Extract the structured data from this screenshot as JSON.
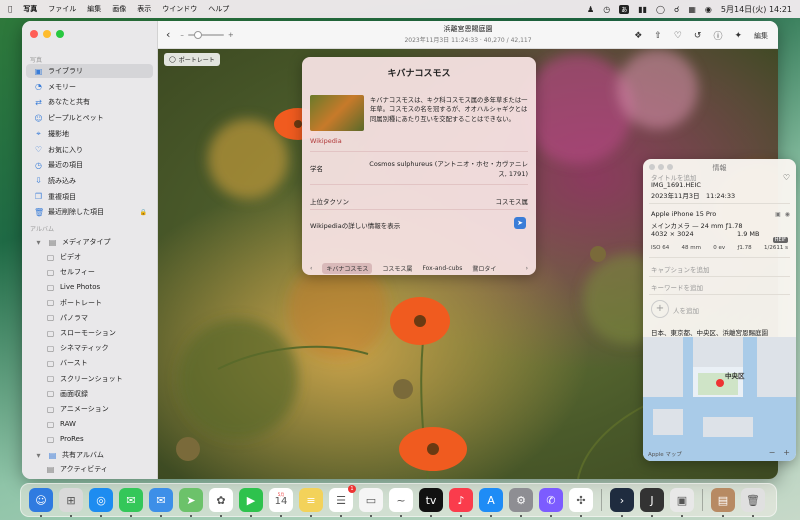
{
  "menubar": {
    "apple_icon": "apple-logo",
    "items": [
      "写真",
      "ファイル",
      "編集",
      "画像",
      "表示",
      "ウインドウ",
      "ヘルプ"
    ],
    "keyboard_badge": "あ",
    "datetime": "5月14日(火) 14:21"
  },
  "sidebar": {
    "section_photos": "写真",
    "items": [
      {
        "label": "ライブラリ",
        "icon": "photo-library-icon",
        "selected": true
      },
      {
        "label": "メモリー",
        "icon": "memories-icon"
      },
      {
        "label": "あなたと共有",
        "icon": "shared-with-you-icon"
      },
      {
        "label": "ピープルとペット",
        "icon": "people-icon"
      },
      {
        "label": "撮影地",
        "icon": "places-icon"
      },
      {
        "label": "お気に入り",
        "icon": "heart-icon"
      },
      {
        "label": "最近の項目",
        "icon": "clock-icon"
      },
      {
        "label": "読み込み",
        "icon": "import-icon"
      },
      {
        "label": "重複項目",
        "icon": "duplicates-icon"
      },
      {
        "label": "最近削除した項目",
        "icon": "trash-icon",
        "locked": true
      }
    ],
    "section_albums": "アルバム",
    "media_types": {
      "label": "メディアタイプ",
      "items": [
        {
          "label": "ビデオ",
          "icon": "video-icon"
        },
        {
          "label": "セルフィー",
          "icon": "selfie-icon"
        },
        {
          "label": "Live Photos",
          "icon": "live-photo-icon"
        },
        {
          "label": "ポートレート",
          "icon": "portrait-icon"
        },
        {
          "label": "パノラマ",
          "icon": "panorama-icon"
        },
        {
          "label": "スローモーション",
          "icon": "slomo-icon"
        },
        {
          "label": "シネマティック",
          "icon": "cinematic-icon"
        },
        {
          "label": "バースト",
          "icon": "burst-icon"
        },
        {
          "label": "スクリーンショット",
          "icon": "screenshot-icon"
        },
        {
          "label": "画面収録",
          "icon": "screen-recording-icon"
        },
        {
          "label": "アニメーション",
          "icon": "animation-icon"
        },
        {
          "label": "RAW",
          "icon": "raw-icon"
        },
        {
          "label": "ProRes",
          "icon": "prores-icon"
        }
      ]
    },
    "shared_albums": {
      "label": "共有アルバム",
      "child": "アクティビティ"
    }
  },
  "toolbar": {
    "title": "浜離宮恩賜庭園",
    "subtitle": "2023年11月3日 11:24:33  ·  40,270 / 42,117",
    "edit_label": "編集",
    "zoom_minus": "–",
    "zoom_plus": "+"
  },
  "photo": {
    "portrait_badge": "ポートレート"
  },
  "lookup": {
    "title": "キバナコスモス",
    "description": "キバナコスモスは、キク科コスモス属の多年草または一年草。コスモスの名を冠するが、オオハルシャギクとは同属別種にあたり互いを交配することはできない。",
    "source": "Wikipedia",
    "rows": [
      {
        "label": "学名",
        "value": "Cosmos sulphureus (アントニオ・ホセ・カヴァニレス, 1791)"
      },
      {
        "label": "上位タクソン",
        "value": "コスモス属"
      }
    ],
    "more_label": "Wikipediaの詳しい情報を表示",
    "tabs": [
      "キバナコスモス",
      "コスモス属",
      "Fox-and-cubs",
      "鵞ロタイ"
    ],
    "selected_tab": 0
  },
  "info": {
    "header": "情報",
    "title_placeholder": "タイトルを追加",
    "filename": "IMG_1691.HEIC",
    "datetime": "2023年11月3日　11:24:33",
    "device": "Apple iPhone 15 Pro",
    "camera": "メインカメラ — 24 mm ƒ1.78",
    "resolution": "4032 × 3024",
    "filesize": "1.9 MB",
    "format_tag": "HEIF",
    "exif": [
      "ISO 64",
      "48 mm",
      "0 ev",
      "ƒ1.78",
      "1/2611 s"
    ],
    "caption_placeholder": "キャプションを追加",
    "keyword_placeholder": "キーワードを追加",
    "add_person": "人を追加",
    "location": "日本、東京都、中央区、浜離宮恩賜庭園",
    "map": {
      "district": "中央区",
      "attribution": "Apple マップ",
      "zoom_minus": "−",
      "zoom_plus": "+"
    }
  },
  "dock": {
    "apps": [
      {
        "name": "finder-app",
        "color": "#2f7be0",
        "glyph": "☺"
      },
      {
        "name": "launchpad-app",
        "color": "#d9d9d9",
        "glyph": "⊞"
      },
      {
        "name": "safari-app",
        "color": "#1d8cf0",
        "glyph": "◎"
      },
      {
        "name": "messages-app",
        "color": "#34c759",
        "glyph": "✉"
      },
      {
        "name": "mail-app",
        "color": "#3d8fe8",
        "glyph": "✉"
      },
      {
        "name": "maps-app",
        "color": "#6cc26a",
        "glyph": "➤"
      },
      {
        "name": "photos-app",
        "color": "#ffffff",
        "glyph": "✿"
      },
      {
        "name": "facetime-app",
        "color": "#2ec24d",
        "glyph": "▶"
      },
      {
        "name": "calendar-app",
        "color": "#ffffff",
        "glyph": "14",
        "month": "5月"
      },
      {
        "name": "notes-app",
        "color": "#f3d25a",
        "glyph": "≡"
      },
      {
        "name": "reminders-app",
        "color": "#ffffff",
        "glyph": "☰",
        "badge": "1"
      },
      {
        "name": "freeform-app",
        "color": "#f5f5f5",
        "glyph": "▭"
      },
      {
        "name": "freeform2-app",
        "color": "#ffffff",
        "glyph": "~"
      },
      {
        "name": "appletv-app",
        "color": "#111111",
        "glyph": "tv"
      },
      {
        "name": "music-app",
        "color": "#fa3c4c",
        "glyph": "♪"
      },
      {
        "name": "appstore-app",
        "color": "#1e8cf6",
        "glyph": "A"
      },
      {
        "name": "settings-app",
        "color": "#8e8e93",
        "glyph": "⚙"
      },
      {
        "name": "messenger-app",
        "color": "#7c5cff",
        "glyph": "✆"
      },
      {
        "name": "chatgpt-app",
        "color": "#ffffff",
        "glyph": "✣"
      },
      {
        "name": "sep"
      },
      {
        "name": "terminal-app",
        "color": "#1f2c3f",
        "glyph": "›"
      },
      {
        "name": "jetbrains-app",
        "color": "#333333",
        "glyph": "J"
      },
      {
        "name": "preview-app",
        "color": "#e8e8e8",
        "glyph": "▣"
      },
      {
        "name": "sep"
      },
      {
        "name": "downloads-stack",
        "color": "#b78a63",
        "glyph": "▤"
      },
      {
        "name": "trash-app",
        "color": "#e0e0e0",
        "glyph": "🗑"
      }
    ]
  },
  "colors": {
    "accent": "#3a7dd8",
    "close": "#ff5f57",
    "minimize": "#febc2e",
    "zoom": "#28c840"
  }
}
